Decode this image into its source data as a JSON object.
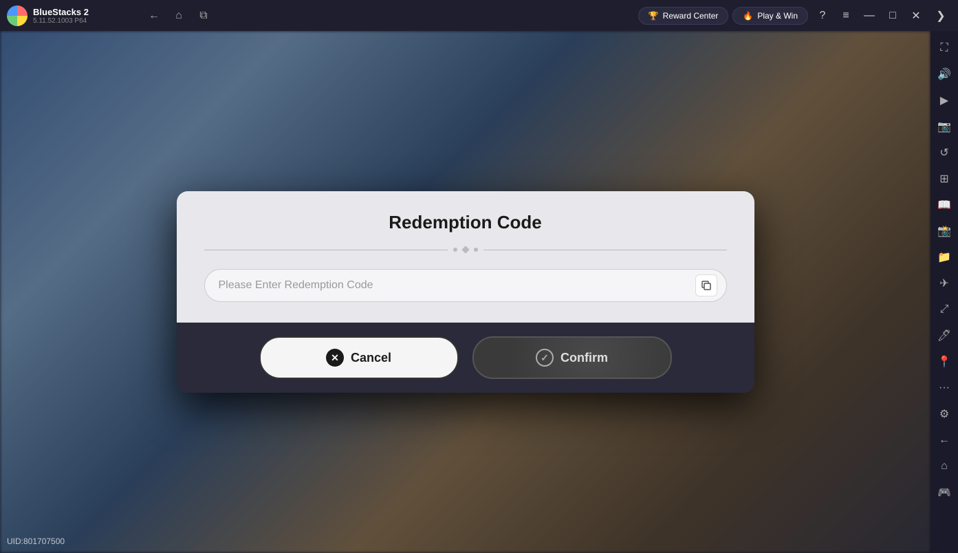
{
  "app": {
    "name": "BlueStacks 2",
    "version": "5.11.52.1003  P64"
  },
  "topbar": {
    "nav_back_label": "←",
    "nav_home_label": "⌂",
    "nav_copy_label": "❐",
    "reward_center_label": "Reward Center",
    "play_win_label": "Play & Win",
    "help_icon": "?",
    "menu_icon": "≡",
    "minimize_icon": "—",
    "maximize_icon": "□",
    "close_icon": "✕",
    "expand_icon": "⟩"
  },
  "sidebar": {
    "icons": [
      {
        "name": "fullscreen-icon",
        "symbol": "⛶"
      },
      {
        "name": "volume-icon",
        "symbol": "🔊"
      },
      {
        "name": "video-icon",
        "symbol": "▶"
      },
      {
        "name": "camera-icon",
        "symbol": "📷"
      },
      {
        "name": "refresh-icon",
        "symbol": "↺"
      },
      {
        "name": "layers-icon",
        "symbol": "⊞"
      },
      {
        "name": "book-icon",
        "symbol": "📖"
      },
      {
        "name": "screenshot-icon",
        "symbol": "📸"
      },
      {
        "name": "folder-icon",
        "symbol": "📁"
      },
      {
        "name": "airplane-icon",
        "symbol": "✈"
      },
      {
        "name": "resize-icon",
        "symbol": "⤢"
      },
      {
        "name": "brush-icon",
        "symbol": "🖊"
      },
      {
        "name": "location-icon",
        "symbol": "📍"
      },
      {
        "name": "more-icon",
        "symbol": "···"
      },
      {
        "name": "settings-icon",
        "symbol": "⚙"
      },
      {
        "name": "back-icon",
        "symbol": "←"
      },
      {
        "name": "home2-icon",
        "symbol": "⌂"
      },
      {
        "name": "gamepad-icon",
        "symbol": "🎮"
      }
    ]
  },
  "modal": {
    "title": "Redemption Code",
    "input_placeholder": "Please Enter Redemption Code",
    "cancel_label": "Cancel",
    "confirm_label": "Confirm"
  },
  "footer": {
    "uid_label": "UID:801707500"
  }
}
